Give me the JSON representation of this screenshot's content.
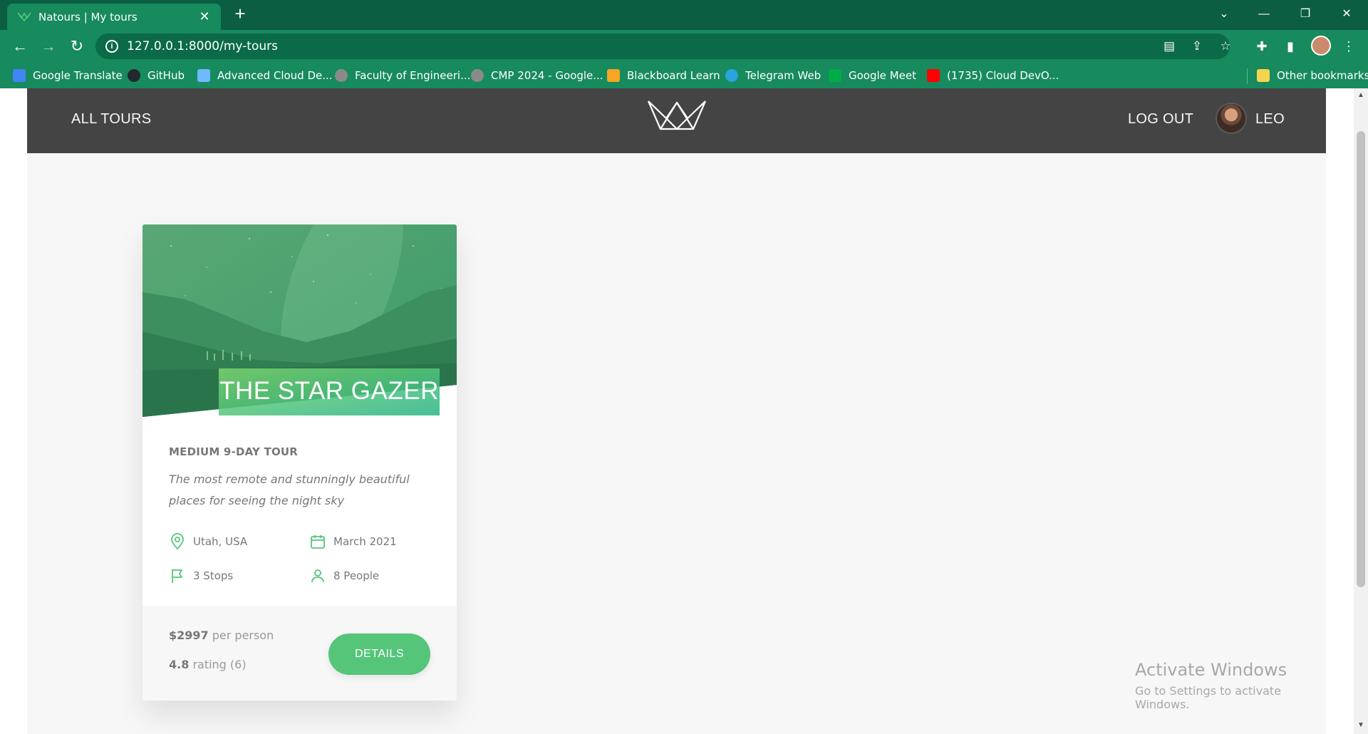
{
  "browser": {
    "tab_title": "Natours | My tours",
    "tab_close": "✕",
    "new_tab": "+",
    "url": "127.0.0.1:8000/my-tours",
    "window": {
      "minimize": "—",
      "restore": "❐",
      "close": "✕",
      "tab_search": "⌄"
    },
    "bookmarks": [
      {
        "label": "Google Translate",
        "icon": "google-translate-icon",
        "color": "#4285f4"
      },
      {
        "label": "GitHub",
        "icon": "github-icon",
        "color": "#24292e"
      },
      {
        "label": "Advanced Cloud De...",
        "icon": "udemy-icon",
        "color": "#6fb9ff"
      },
      {
        "label": "Faculty of Engineeri...",
        "icon": "globe-icon",
        "color": "#8a8a8a"
      },
      {
        "label": "CMP 2024 - Google...",
        "icon": "globe-icon",
        "color": "#8a8a8a"
      },
      {
        "label": "Blackboard Learn",
        "icon": "blackboard-icon",
        "color": "#f5a623"
      },
      {
        "label": "Telegram Web",
        "icon": "telegram-icon",
        "color": "#2aa3de"
      },
      {
        "label": "Google Meet",
        "icon": "google-meet-icon",
        "color": "#00ac47"
      },
      {
        "label": "(1735) Cloud DevO...",
        "icon": "youtube-icon",
        "color": "#ff0000"
      }
    ],
    "other_bookmarks": "Other bookmarks"
  },
  "header": {
    "all_tours": "ALL TOURS",
    "log_out": "LOG OUT",
    "user_name": "LEO"
  },
  "tour": {
    "name": "THE STAR GAZER",
    "subheading": "MEDIUM 9-DAY TOUR",
    "summary": "The most remote and stunningly beautiful places for seeing the night sky",
    "location": "Utah, USA",
    "date": "March 2021",
    "stops": "3 Stops",
    "people": "8 People",
    "price": "$2997",
    "price_unit": "per person",
    "rating": "4.8",
    "rating_label": "rating (6)",
    "details": "DETAILS"
  },
  "watermark": {
    "title": "Activate Windows",
    "subtitle": "Go to Settings to activate Windows."
  },
  "colors": {
    "brand_green": "#55c57a",
    "header_gray": "#444444",
    "chrome_dark": "#0b5e42",
    "chrome_light": "#178a5e"
  }
}
